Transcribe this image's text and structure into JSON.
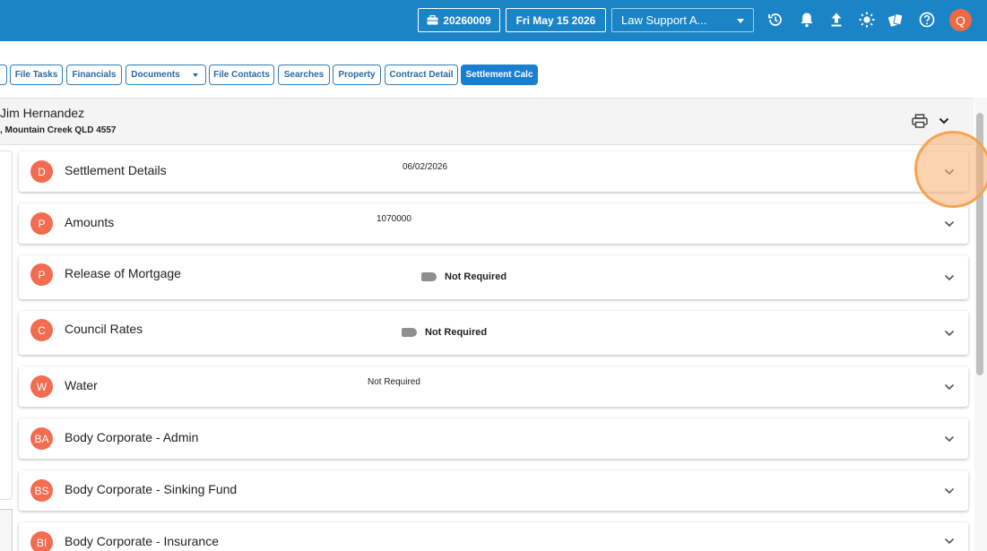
{
  "topbar": {
    "file_number": "20260009",
    "date": "Fri May 15 2026",
    "firm_select": "Law Support A...",
    "avatar_letter": "Q",
    "icons": [
      "briefcase-icon",
      "history-icon",
      "bell-icon",
      "upload-icon",
      "brightness-icon",
      "cards-icon",
      "help-icon"
    ]
  },
  "tabs": [
    {
      "label": "File Tasks"
    },
    {
      "label": "Financials"
    },
    {
      "label": "Documents"
    },
    {
      "label": "File Contacts"
    },
    {
      "label": "Searches"
    },
    {
      "label": "Property"
    },
    {
      "label": "Contract Detail"
    },
    {
      "label": "Settlement Calc",
      "active": true
    }
  ],
  "client": {
    "name": "Jim Hernandez",
    "address": ", Mountain Creek QLD 4557"
  },
  "sections": [
    {
      "badge": "D",
      "title": "Settlement Details",
      "value": "06/02/2026"
    },
    {
      "badge": "P",
      "title": "Amounts",
      "value": "1070000"
    },
    {
      "badge": "P",
      "title": "Release of Mortgage",
      "toggle_label": "Not Required"
    },
    {
      "badge": "C",
      "title": "Council Rates",
      "toggle_label": "Not Required"
    },
    {
      "badge": "W",
      "title": "Water",
      "value": "Not Required"
    },
    {
      "badge": "BA",
      "title": "Body Corporate - Admin"
    },
    {
      "badge": "BS",
      "title": "Body Corporate - Sinking Fund"
    },
    {
      "badge": "BI",
      "title": "Body Corporate - Insurance"
    }
  ],
  "colors": {
    "topbar": "#1b84c6",
    "badge": "#f26c4f",
    "active_tab": "#1b7fd1",
    "avatar": "#ef6a3f"
  }
}
